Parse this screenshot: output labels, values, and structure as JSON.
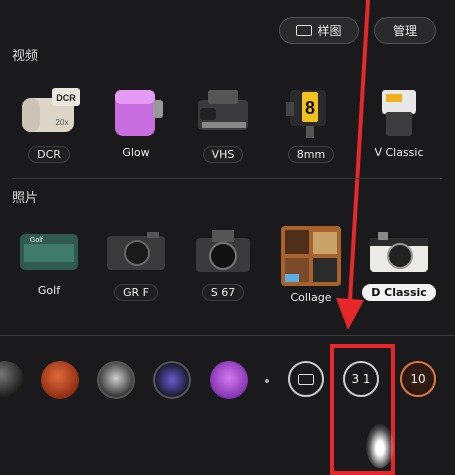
{
  "top_bar": {
    "sample_label": "样图",
    "manage_label": "管理"
  },
  "video": {
    "title": "视频",
    "items": [
      {
        "label": "DCR",
        "badge": "DCR",
        "zoom": "20x"
      },
      {
        "label": "Glow"
      },
      {
        "label": "VHS"
      },
      {
        "label": "8mm",
        "badge": "8"
      },
      {
        "label": "V Classic"
      }
    ]
  },
  "photo": {
    "title": "照片",
    "items": [
      {
        "label": "Golf",
        "badge": "Golf"
      },
      {
        "label": "GR F"
      },
      {
        "label": "S 67"
      },
      {
        "label": "Collage"
      },
      {
        "label": "D Classic",
        "selected": true
      }
    ]
  },
  "controls": {
    "timer": "3 1",
    "shot_count": "10"
  },
  "colors": {
    "highlight": "#e8272b",
    "background": "#1a1a1c"
  }
}
